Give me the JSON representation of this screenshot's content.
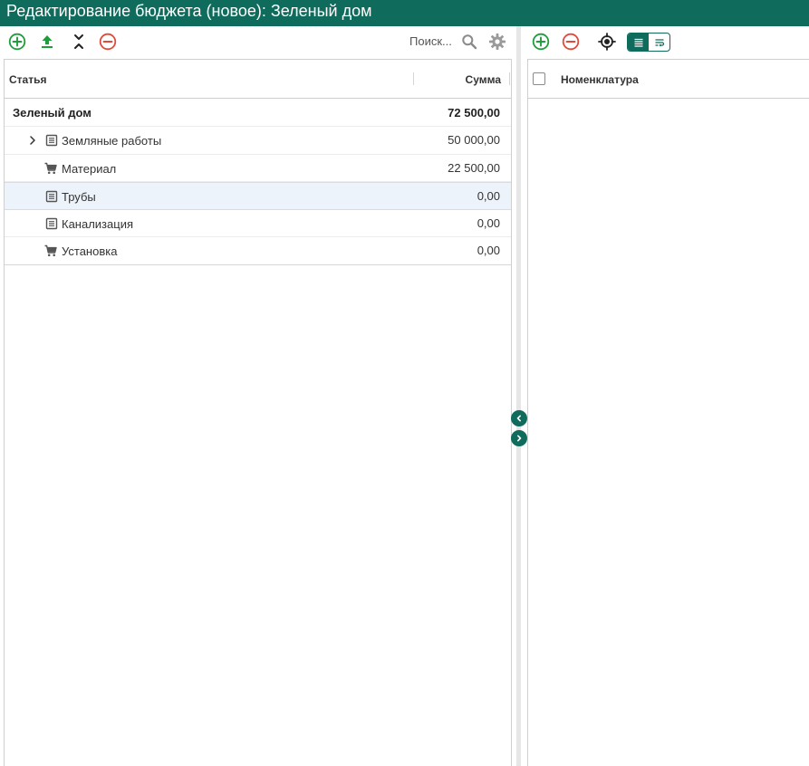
{
  "window": {
    "title": "Редактирование бюджета (новое): Зеленый дом"
  },
  "left_toolbar": {
    "add_icon": "plus-circle-icon",
    "upload_icon": "upload-icon",
    "collapse_icon": "collapse-all-icon",
    "remove_icon": "minus-circle-icon",
    "search_label": "Поиск...",
    "search_icon": "search-icon",
    "settings_icon": "gear-icon"
  },
  "left_table": {
    "columns": [
      "Статья",
      "Сумма"
    ],
    "rows": [
      {
        "label": "Зеленый дом",
        "sum": "72 500,00",
        "icon": "none",
        "level": 0
      },
      {
        "label": "Земляные работы",
        "sum": "50 000,00",
        "icon": "document-icon",
        "level": 1,
        "expandable": true
      },
      {
        "label": "Материал",
        "sum": "22 500,00",
        "icon": "cart-icon",
        "level": 1
      },
      {
        "label": "Трубы",
        "sum": "0,00",
        "icon": "document-icon",
        "level": 1,
        "selected": true
      },
      {
        "label": "Канализация",
        "sum": "0,00",
        "icon": "document-icon",
        "level": 1
      },
      {
        "label": "Установка",
        "sum": "0,00",
        "icon": "cart-icon",
        "level": 1
      }
    ]
  },
  "right_toolbar": {
    "add_icon": "plus-circle-icon",
    "remove_icon": "minus-circle-icon",
    "locate_icon": "crosshair-icon",
    "view_list_icon": "list-view-icon",
    "view_wrap_icon": "wrap-view-icon"
  },
  "right_table": {
    "columns": [
      "Номенклатура"
    ]
  },
  "colors": {
    "brand": "#0f6b5c",
    "add": "#1f9d3c",
    "remove": "#e04a3a",
    "selected_row": "#edf3fb"
  }
}
